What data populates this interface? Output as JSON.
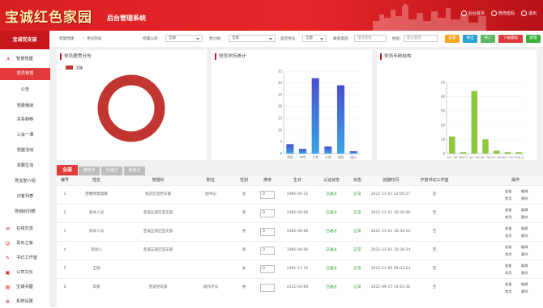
{
  "header": {
    "logo": "宝诚红色家园",
    "subtitle": "后台管理系统",
    "links": [
      "后台首页",
      "修改密码",
      "退出"
    ]
  },
  "sidebar": {
    "title": "宝诚党支部",
    "items": [
      {
        "label": "智慧党建",
        "icon": "party-flag-icon"
      },
      {
        "label": "在线交流",
        "icon": "chat-icon"
      },
      {
        "label": "青年之家",
        "icon": "youth-icon"
      },
      {
        "label": "书记工作室",
        "icon": "pen-icon"
      },
      {
        "label": "公司文化",
        "icon": "building-icon"
      },
      {
        "label": "宝诚书屋",
        "icon": "book-icon"
      },
      {
        "label": "系统设置",
        "icon": "gear-icon"
      }
    ],
    "subitems": [
      "党员管理",
      "公告",
      "党费缴纳",
      "关系转移",
      "三会一课",
      "党建活动",
      "发展生活",
      "党支部介绍",
      "访客列表",
      "党组织列表"
    ]
  },
  "toolbar": {
    "breadcrumb1": "智慧党建",
    "breadcrumb2": "党员列表",
    "filters": [
      {
        "label": "所属公司:",
        "value": "全部"
      },
      {
        "label": "党小组:",
        "value": "全部"
      },
      {
        "label": "是否党员:",
        "value": "全部"
      }
    ],
    "phone_label": "联系电话:",
    "phone_placeholder": "电话查找",
    "name_label": "姓名:",
    "name_placeholder": "姓名查找",
    "buttons": [
      {
        "label": "查看",
        "color": "#f5a623"
      },
      {
        "label": "导出",
        "color": "#29a3d8"
      },
      {
        "label": "导入",
        "color": "#5cb85c"
      },
      {
        "label": "下载模板",
        "color": "#e23a3a"
      },
      {
        "label": "新增",
        "color": "#3bb13b"
      }
    ]
  },
  "charts": {
    "dues": {
      "title": "党员籍贯分布"
    },
    "education": {
      "title": "党员学历统计"
    },
    "age": {
      "title": "党员年龄结构"
    }
  },
  "chart_data": [
    {
      "type": "pie",
      "title": "党员籍贯分布",
      "legend": [
        "汉族"
      ],
      "values": [
        1
      ],
      "colors": [
        "#c23531"
      ]
    },
    {
      "type": "bar",
      "title": "党员学历统计",
      "categories": [
        "专科",
        "中专",
        "大专",
        "小学",
        "本科",
        "硕士"
      ],
      "values": [
        4,
        2,
        32,
        3,
        29,
        1
      ],
      "ylim": [
        0,
        35
      ],
      "yticks": [
        0,
        5,
        10,
        15,
        20,
        25,
        30,
        35
      ],
      "color": "blue-gradient"
    },
    {
      "type": "bar",
      "title": "党员年龄结构",
      "categories": [
        "20~30",
        "30以下",
        "30~40",
        "40~50",
        "50~60",
        "60~70",
        "70以上"
      ],
      "values": [
        12,
        1,
        44,
        10,
        2,
        1,
        1
      ],
      "ylim": [
        0,
        50
      ],
      "yticks": [
        0,
        10,
        20,
        30,
        40,
        50
      ],
      "color": "green"
    }
  ],
  "tabs": [
    "全部",
    "审核中",
    "已通过",
    "未通过"
  ],
  "table": {
    "headers": [
      "编号",
      "姓名",
      "党组织",
      "职位",
      "性别",
      "排序",
      "生日",
      "认证状态",
      "状态",
      "创建时间",
      "开放书记工作室",
      "操作"
    ],
    "rows": [
      {
        "no": "1",
        "name": "宏曦党建辐辆",
        "org": "张店区宣党支部",
        "post": "副书记",
        "sex": "女",
        "sort": "0",
        "bday": "1985-05-22",
        "cert": "已通过",
        "state": "正常",
        "time": "2021-11-01 12:56:27",
        "open": "是",
        "ops": [
          "查看",
          "编辑",
          "禁用",
          "删除"
        ]
      },
      {
        "no": "2",
        "name": "测试人员",
        "org": "宝诚五部区宣支部",
        "post": "",
        "sex": "男",
        "sort": "0",
        "bday": "1985-04-06",
        "cert": "已通过",
        "state": "正常",
        "time": "2021-11-01 16:36:06",
        "open": "否",
        "ops": [
          "查看",
          "编辑",
          "禁用",
          "删除"
        ]
      },
      {
        "no": "3",
        "name": "测试人员",
        "org": "宝诚五部区宣支部",
        "post": "",
        "sex": "男",
        "sort": "0",
        "bday": "1985-04-06",
        "cert": "已通过",
        "state": "正常",
        "time": "2021-11-01 16:36:12",
        "open": "否",
        "ops": [
          "查看",
          "编辑",
          "禁用",
          "删除"
        ]
      },
      {
        "no": "4",
        "name": "测试人",
        "org": "宝诚五部区宣支部",
        "post": "",
        "sex": "男",
        "sort": "0",
        "bday": "1985-04-06",
        "cert": "已通过",
        "state": "正常",
        "time": "2021-11-01 16:36:54",
        "open": "否",
        "ops": [
          "查看",
          "编辑",
          "禁用",
          "删除"
        ]
      },
      {
        "no": "5",
        "name": "王刚",
        "org": "",
        "post": "",
        "sex": "女",
        "sort": "0",
        "bday": "1991-11-10",
        "cert": "已通过",
        "state": "正常",
        "time": "2021-11-05 09:03:23",
        "open": "否",
        "ops": [
          "查看",
          "编辑",
          "禁用",
          "删除"
        ]
      },
      {
        "no": "6",
        "name": "李俊",
        "org": "宝诚党支部",
        "post": "副作专员",
        "sex": "男",
        "sort": "",
        "bday": "2021-03-09",
        "cert": "已通过",
        "state": "正常",
        "time": "2021-09-17 14:42:36",
        "open": "否",
        "ops": [
          "查看",
          "编辑",
          "禁用",
          "删除"
        ]
      }
    ]
  }
}
